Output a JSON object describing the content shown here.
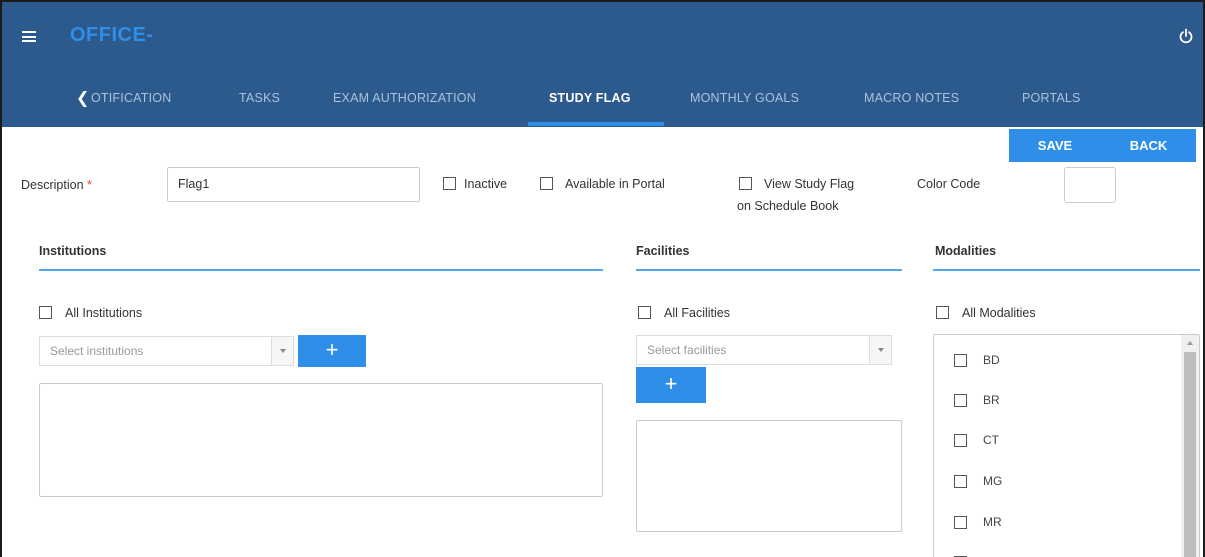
{
  "header": {
    "app_title": "OFFICE-",
    "back_glyph": "❮",
    "tabs": [
      {
        "label": "OTIFICATION",
        "active": false
      },
      {
        "label": "TASKS",
        "active": false
      },
      {
        "label": "EXAM AUTHORIZATION",
        "active": false
      },
      {
        "label": "STUDY FLAG",
        "active": true
      },
      {
        "label": "MONTHLY GOALS",
        "active": false
      },
      {
        "label": "MACRO NOTES",
        "active": false
      },
      {
        "label": "PORTALS",
        "active": false
      }
    ]
  },
  "actions": {
    "save_label": "SAVE",
    "back_label": "BACK"
  },
  "form": {
    "description_label": "Description",
    "required_mark": "*",
    "description_value": "Flag1",
    "inactive_label": "Inactive",
    "portal_label": "Available in Portal",
    "schedule_label_line1": "View Study Flag",
    "schedule_label_line2": "on Schedule Book",
    "color_code_label": "Color Code"
  },
  "institutions": {
    "title": "Institutions",
    "all_label": "All Institutions",
    "placeholder": "Select institutions",
    "add_glyph": "+"
  },
  "facilities": {
    "title": "Facilities",
    "all_label": "All Facilities",
    "placeholder": "Select facilities",
    "add_glyph": "+"
  },
  "modalities": {
    "title": "Modalities",
    "all_label": "All Modalities",
    "items": [
      "BD",
      "BR",
      "CT",
      "MG",
      "MR"
    ]
  },
  "colors": {
    "header_bg": "#2c5a8c",
    "accent": "#2f8fe8"
  },
  "icons": [
    "hamburger-menu-icon",
    "power-icon",
    "chevron-left-icon",
    "plus-icon",
    "dropdown-arrow-icon"
  ]
}
